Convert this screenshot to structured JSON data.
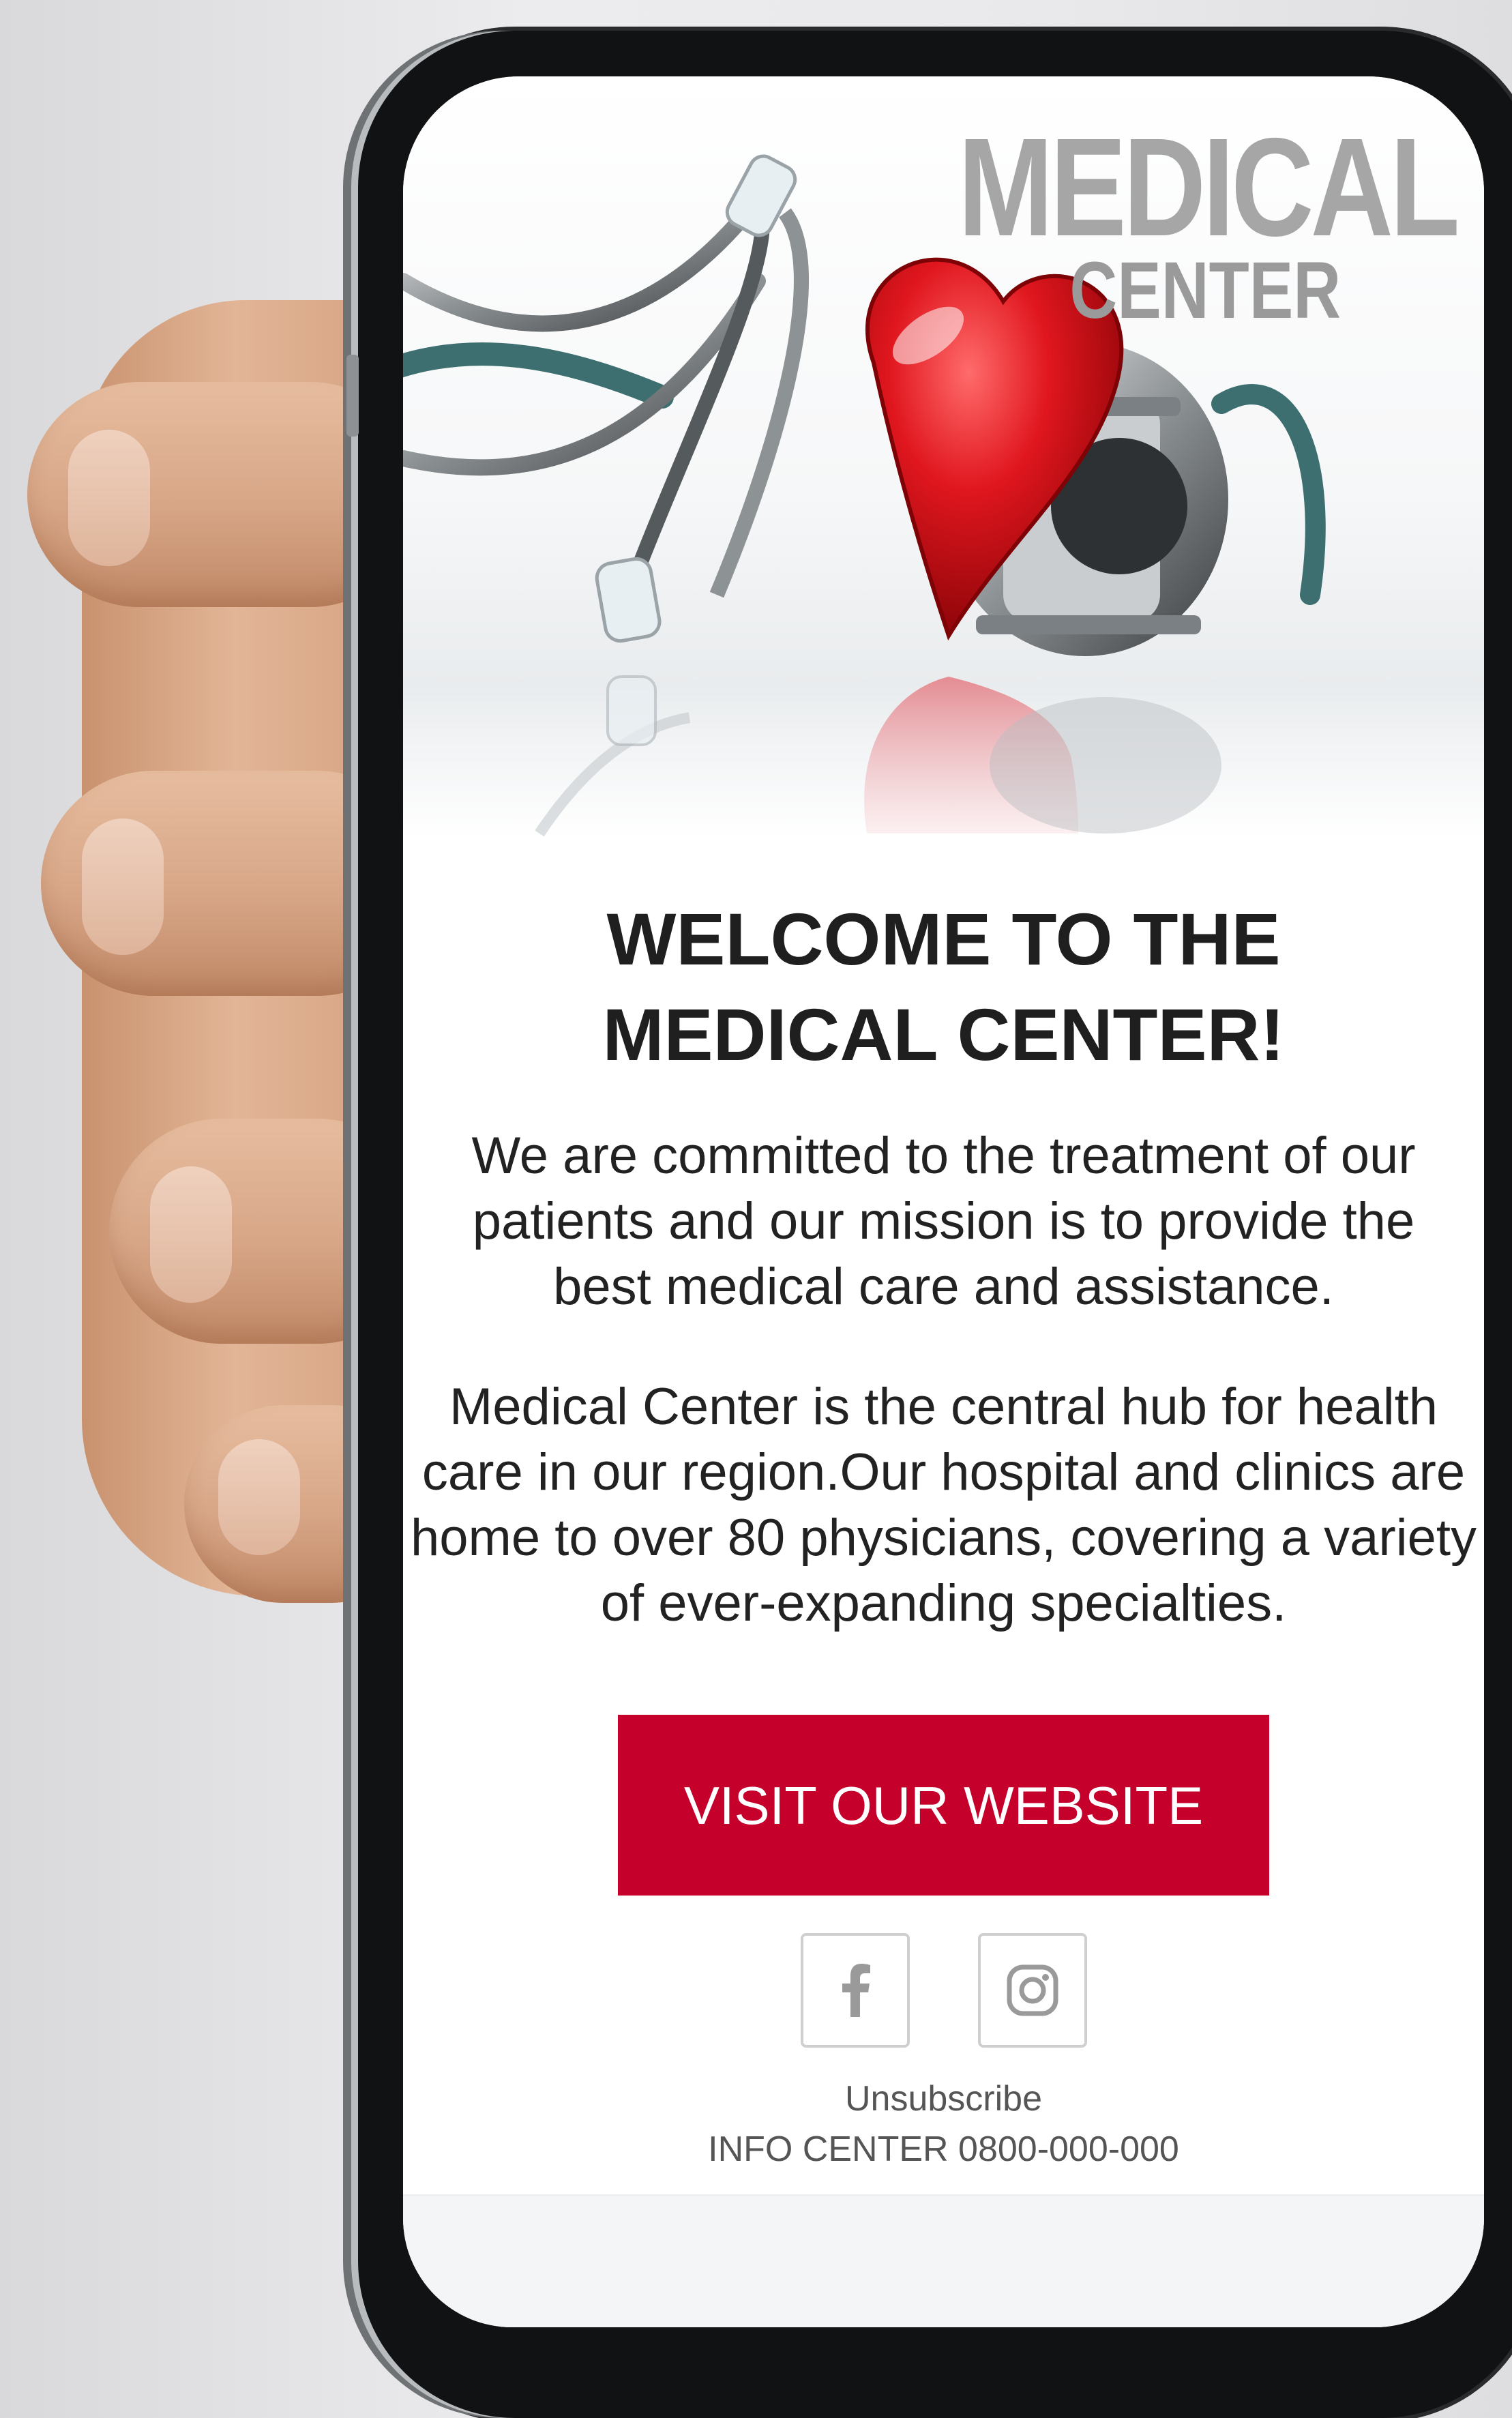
{
  "brand": {
    "main": "MEDICAL",
    "sub": "CENTER"
  },
  "email": {
    "heading": "WELCOME TO THE MEDICAL CENTER!",
    "intro": "We are committed to the treatment of our patients and our mission is to provide the best medical care and assistance.",
    "body": "Medical Center is the central hub for health care in our region.Our hospital and clinics are home to over 80 physicians, covering a variety of ever-expanding specialties.",
    "cta_label": "VISIT OUR WEBSITE"
  },
  "social": {
    "icons": [
      "facebook-icon",
      "instagram-icon"
    ]
  },
  "footer": {
    "unsubscribe": "Unsubscribe",
    "info": "INFO CENTER 0800-000-000"
  },
  "colors": {
    "cta": "#c4002b",
    "heart": "#d8141d",
    "brand_text": "#a6a6a6"
  }
}
